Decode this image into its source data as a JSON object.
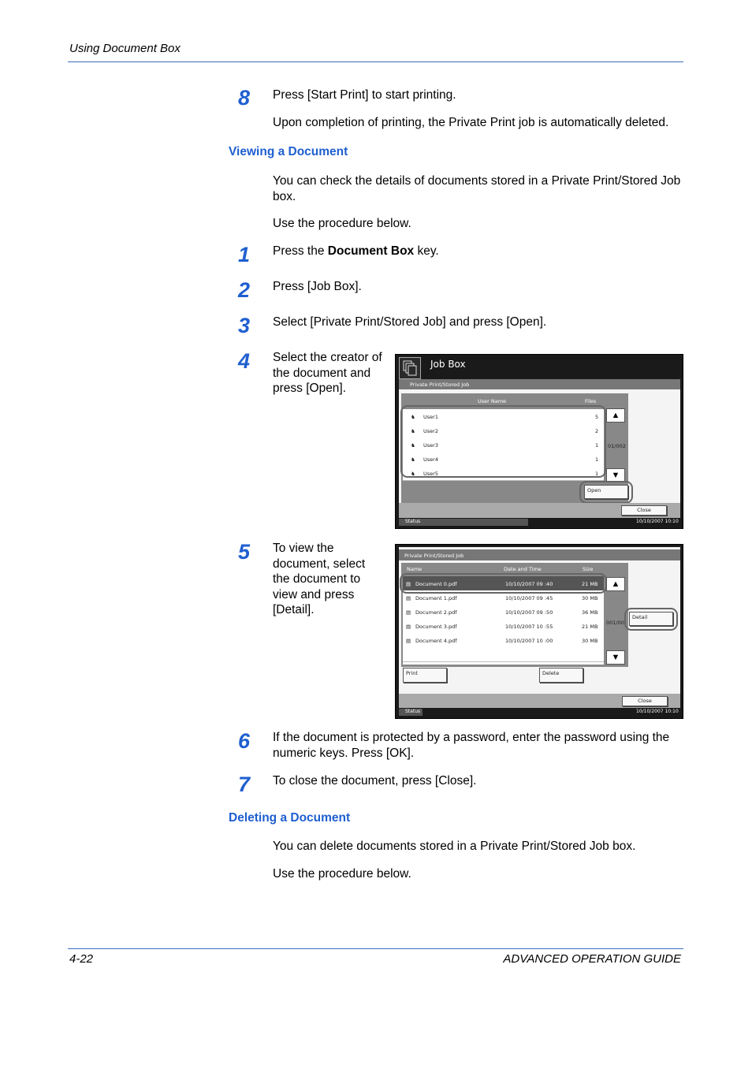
{
  "header": {
    "title": "Using Document Box"
  },
  "steps_top": [
    {
      "num": "8",
      "text": "Press [Start Print] to start printing."
    }
  ],
  "step8_note": "Upon completion of printing, the Private Print job is automatically deleted.",
  "section_viewing": {
    "title": "Viewing a Document",
    "intro": "You can check the details of documents stored in a Private Print/Stored Job box.",
    "procedure": "Use the procedure below."
  },
  "steps": {
    "s1": {
      "num": "1",
      "pre": "Press the ",
      "bold": "Document Box",
      "post": " key."
    },
    "s2": {
      "num": "2",
      "text": "Press [Job Box]."
    },
    "s3": {
      "num": "3",
      "text": "Select [Private Print/Stored Job] and press [Open]."
    },
    "s4": {
      "num": "4",
      "line1": "Select the creator of",
      "line2": "the document and",
      "line3": "press [Open]."
    },
    "s5": {
      "num": "5",
      "line1": "To view the",
      "line2": "document, select",
      "line3": "the document to",
      "line4": "view and press",
      "line5": "[Detail]."
    },
    "s6": {
      "num": "6",
      "line1": "If the document is protected by a password, enter the password using the",
      "line2": "numeric keys. Press [OK]."
    },
    "s7": {
      "num": "7",
      "text": "To close the document, press [Close]."
    }
  },
  "screen1": {
    "title": "Job Box",
    "subtitle": "Private Print/Stored Job",
    "col_user": "User Name",
    "col_files": "Files",
    "rows": [
      {
        "name": "User1",
        "files": "5"
      },
      {
        "name": "User2",
        "files": "2"
      },
      {
        "name": "User3",
        "files": "1"
      },
      {
        "name": "User4",
        "files": "1"
      },
      {
        "name": "User5",
        "files": "1"
      }
    ],
    "page": "01/002",
    "open": "Open",
    "close": "Close",
    "status": "Status",
    "datetime": "10/10/2007    10:10"
  },
  "screen2": {
    "subtitle": "Private Print/Stored Job",
    "col_name": "Name",
    "col_date": "Date and Time",
    "col_size": "Size",
    "rows": [
      {
        "name": "Document 0.pdf",
        "date": "10/10/2007  09 :40",
        "size": "21 MB"
      },
      {
        "name": "Document 1.pdf",
        "date": "10/10/2007  09 :45",
        "size": "30 MB"
      },
      {
        "name": "Document 2.pdf",
        "date": "10/10/2007  09 :50",
        "size": "36 MB"
      },
      {
        "name": "Document 3.pdf",
        "date": "10/10/2007  10 :55",
        "size": "21 MB"
      },
      {
        "name": "Document 4.pdf",
        "date": "10/10/2007  10 :00",
        "size": "30 MB"
      }
    ],
    "page": "001/00",
    "detail": "Detail",
    "print": "Print",
    "delete": "Delete",
    "close": "Close",
    "status": "Status",
    "datetime": "10/10/2007    10:10"
  },
  "section_deleting": {
    "title": "Deleting a Document",
    "intro": "You can delete documents stored in a Private Print/Stored Job box.",
    "procedure": "Use the procedure below."
  },
  "footer": {
    "page": "4-22",
    "guide": "ADVANCED OPERATION GUIDE"
  },
  "colors": {
    "accent": "#1f5fd0",
    "rule": "#3a6fc0"
  }
}
